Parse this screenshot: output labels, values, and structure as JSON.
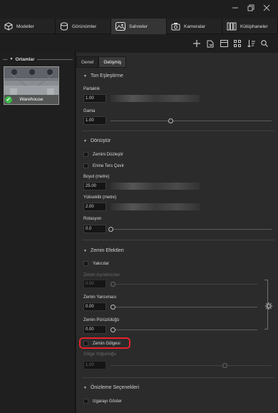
{
  "tabs": [
    {
      "label": "Modeller",
      "icon": "cube-icon"
    },
    {
      "label": "Görünümler",
      "icon": "cylinder-icon"
    },
    {
      "label": "Sahneler",
      "icon": "landscape-icon"
    },
    {
      "label": "Kameralar",
      "icon": "camera-icon"
    },
    {
      "label": "Kütüphaneler",
      "icon": "library-icon"
    }
  ],
  "active_tab": "Sahneler",
  "toolbar_icons": [
    "plus-icon",
    "import-icon",
    "panel-icon",
    "grid-icon",
    "sort-icon",
    "search-icon"
  ],
  "left_panel": {
    "header": "Ortamlar",
    "items": [
      {
        "label": "Warehouse",
        "selected": true
      }
    ]
  },
  "subtabs": [
    "Genel",
    "Gelişmiş"
  ],
  "active_subtab": "Gelişmiş",
  "tone": {
    "title": "Ton Eşleştirme",
    "brightness_label": "Parlaklık",
    "brightness_value": "1.00",
    "gamma_label": "Gama",
    "gamma_value": "1.00",
    "gamma_level": 0.37
  },
  "transform": {
    "title": "Dönüştür",
    "flatten_label": "Zemini Düzleştir",
    "flip_label": "Enine Ters Çevir",
    "size_label": "Boyut (metre)",
    "size_value": "25.00",
    "height_label": "Yükseklik (metre)",
    "height_value": "2.00",
    "rotation_label": "Rotasyon",
    "rotation_value": "0.0",
    "rotation_level": 0.0
  },
  "ground": {
    "title": "Zemin Efektleri",
    "shadow_catcher_label": "Yakıcılar",
    "occlusion_label": "Zemin Aşındırıcıları",
    "occlusion_value": "0.00",
    "reflection_label": "Zemin Yansıması",
    "reflection_value": "0.00",
    "roughness_label": "Zemin Pürüzlülüğü",
    "roughness_value": "0.00",
    "shadows_label": "Zemin Gölgesi",
    "shadow_intensity_label": "Gölge Yoğunluğu",
    "shadow_intensity_value": "1.00",
    "shadow_intensity_level": 0.71
  },
  "preview": {
    "title": "Önizleme Seçenekleri",
    "grid_label": "Izgarayı Göster"
  },
  "colors": {
    "highlight": "#e4232a",
    "check": "#3dbb4a"
  }
}
